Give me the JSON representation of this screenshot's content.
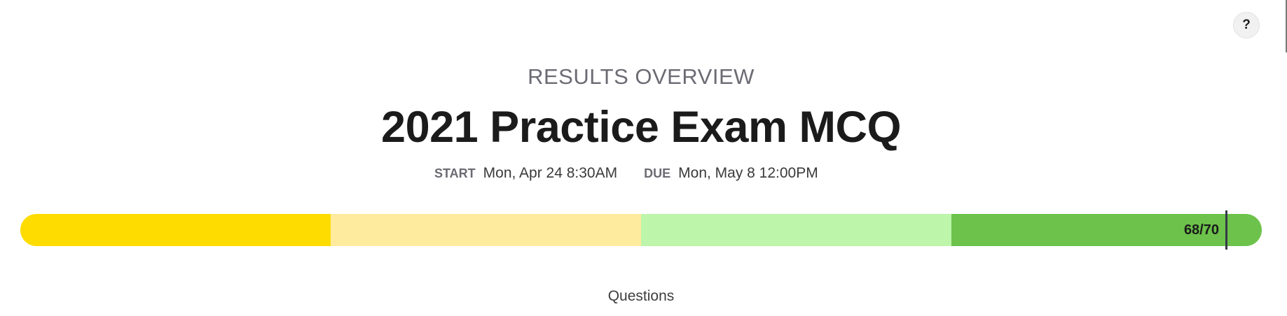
{
  "help": {
    "label": "?"
  },
  "header": {
    "eyebrow": "RESULTS OVERVIEW",
    "title": "2021 Practice Exam MCQ"
  },
  "dates": {
    "start_label": "START",
    "start_value": "Mon, Apr 24 8:30AM",
    "due_label": "DUE",
    "due_value": "Mon, May 8 12:00PM"
  },
  "score": {
    "earned": 68,
    "total": 70,
    "display": "68/70",
    "band_colors": [
      "#fedc00",
      "#feeb9d",
      "#bdf5aa",
      "#6cc24a"
    ],
    "marker_color": "#333a45"
  },
  "sections": {
    "questions_label": "Questions"
  }
}
